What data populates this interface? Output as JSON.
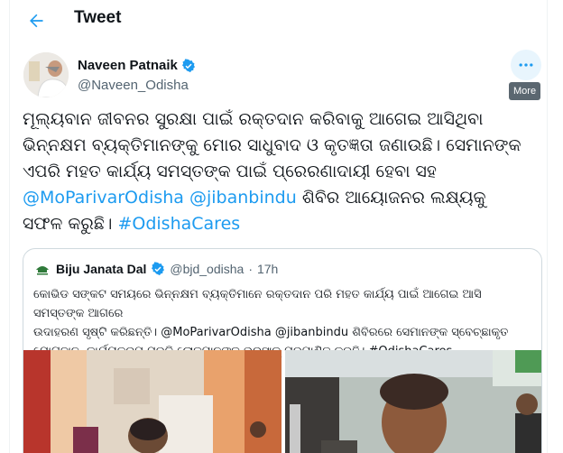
{
  "header": {
    "back_icon": "arrow-left-icon",
    "title": "Tweet"
  },
  "tweet": {
    "author_name": "Naveen Patnaik",
    "author_handle": "@Naveen_Odisha",
    "verified_icon": "verified-badge-icon",
    "more_icon": "more-horizontal-icon",
    "more_tooltip": "More",
    "text_line1": "ମୂଲ୍ୟବାନ ଜୀବନର ସୁରକ୍ଷା ପାଇଁ ରକ୍ତଦାନ କରିବାକୁ ଆଗେଇ ଆସିଥିବା",
    "text_line2": "ଭିନ୍ନକ୍ଷମ ବ୍ୟକ୍ତିମାନଙ୍କୁ ମୋର ସାଧୁବାଦ ଓ କୃତଜ୍ଞତା ଜଣାଉଛି। ସେମାନଙ୍କ",
    "text_line3": "ଏପରି ମହତ କାର୍ଯ୍ୟ ସମସ୍ତଙ୍କ ପାଇଁ ପ୍ରେରଣାଦାୟୀ ହେବା ସହ",
    "mention1": "@MoParivarOdisha",
    "mention2": "@jibanbindu",
    "text_line4_rest": " ଶିବିର ଆୟୋଜନର ଲକ୍ଷ୍ୟକୁ",
    "text_line5": "ସଫଳ କରୁଛି। ",
    "hashtag": "#OdishaCares"
  },
  "quoted_tweet": {
    "author_name": "Biju Janata Dal",
    "author_handle": "@bjd_odisha",
    "separator": "·",
    "time": "17h",
    "line1": "କୋଭିଡ ସଙ୍କଟ ସମୟରେ ଭିନ୍ନକ୍ଷମ ବ୍ୟକ୍ତିମାନେ ରକ୍ତଦାନ ପରି ମହତ କାର୍ଯ୍ୟ ପାଇଁ ଆଗେଇ ଆସି ସମସ୍ତଙ୍କ ଆଗରେ",
    "line2": "ଉଦାହରଣ ସୃଷ୍ଟି କରିଛନ୍ତି। @MoParivarOdisha @jibanbindu ଶିବିରରେ ସେମାନଙ୍କ ସ୍ବେଚ୍ଛାକୃତ",
    "line3": "ଯୋଗଦାନ, କାର୍ଯ୍ୟକ୍ରମ ପ୍ରତି ଲୋକମାନଙ୍କ ଭରସାକୁ ପ୍ରମାଣିତ କରୁଛି। #OdishaCares"
  },
  "colors": {
    "accent": "#1d9bf0",
    "text": "#0f1419",
    "secondary": "#536471",
    "border": "#cfd9de"
  }
}
